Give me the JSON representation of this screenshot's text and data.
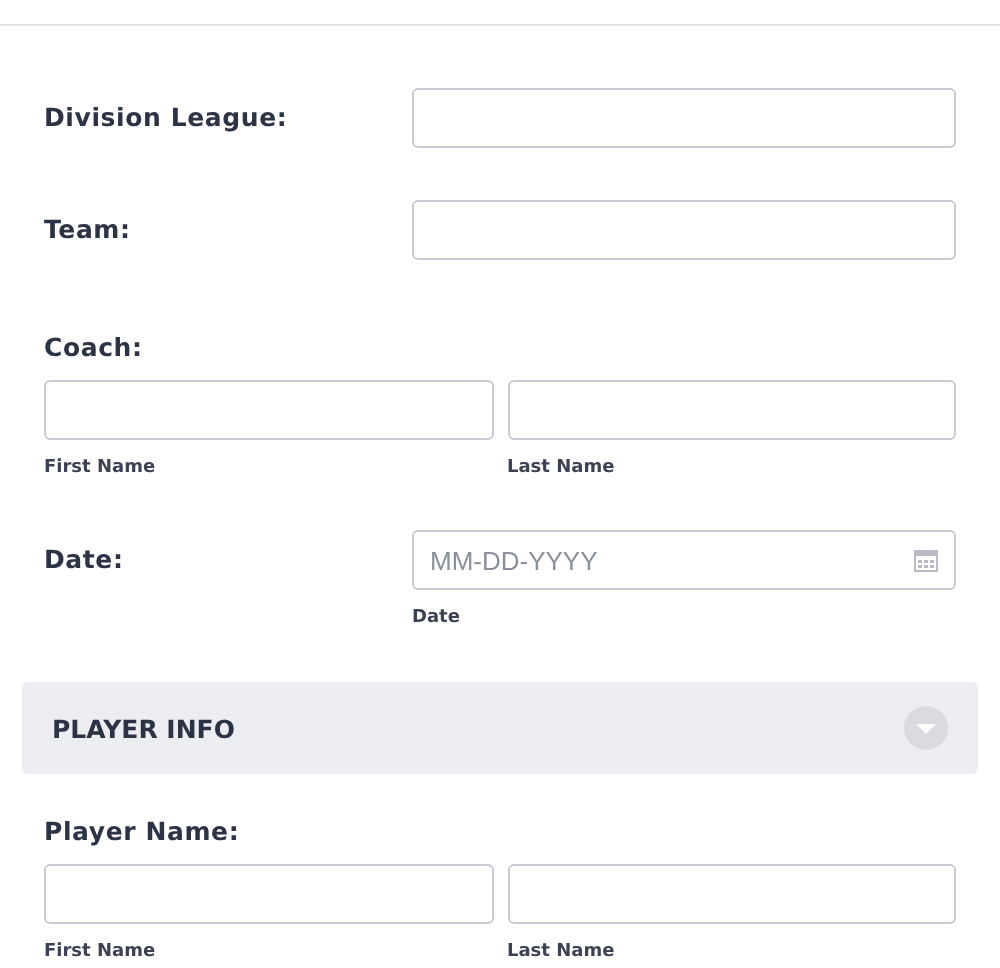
{
  "fields": [
    {
      "kind": "single",
      "label": "Division League:"
    },
    {
      "kind": "single",
      "label": "Team:"
    },
    {
      "kind": "name",
      "label": "Coach:",
      "sublabels": [
        "First Name",
        "Last Name"
      ]
    },
    {
      "kind": "date",
      "label": "Date:",
      "placeholder": "MM-DD-YYYY",
      "sublabel": "Date"
    }
  ],
  "section": {
    "title": "PLAYER INFO"
  },
  "section_fields": [
    {
      "kind": "name",
      "label": "Player Name:",
      "sublabels": [
        "First Name",
        "Last Name"
      ]
    }
  ]
}
